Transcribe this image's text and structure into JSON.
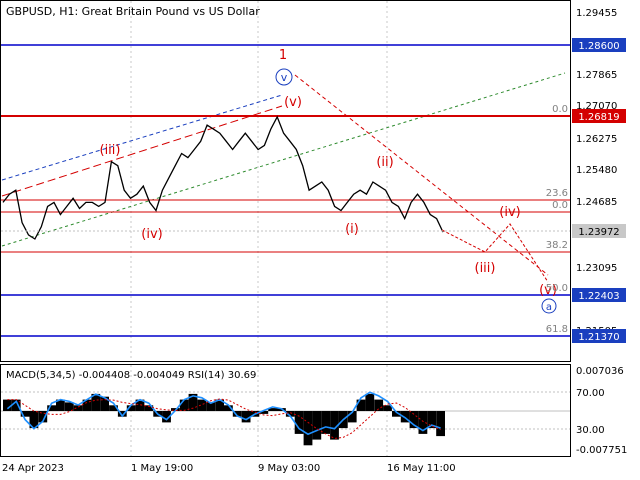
{
  "header": {
    "symbol": "GBPUSD",
    "timeframe": "H1",
    "title": "GBPUSD, H1:  Great Britain Pound vs US Dollar"
  },
  "colors": {
    "price_line": "#000000",
    "red_level": "#d40000",
    "blue_level": "#0000cc",
    "price_label_bg": "#1a3fbf",
    "wave_label": "#d40000",
    "wave_blue": "#1a3fbf",
    "trend_green": "#2e8b2e",
    "fib_text": "#808080",
    "macd_blue": "#1e90ff",
    "macd_hist": "#000000"
  },
  "chart_data": [
    {
      "type": "line",
      "panel": "price",
      "x_labels": [
        "24 Apr 2023",
        "1 May 19:00",
        "9 May 03:00",
        "16 May 11:00"
      ],
      "y_ticks": [
        "1.29455",
        "1.27865",
        "1.27070",
        "1.26275",
        "1.25480",
        "1.24685",
        "1.23095",
        "1.21505"
      ],
      "ylim": [
        1.208,
        1.2965
      ],
      "series": [
        {
          "values": [
            1.247,
            1.249,
            1.25,
            1.242,
            1.239,
            1.238,
            1.241,
            1.246,
            1.247,
            1.244,
            1.246,
            1.248,
            1.2455,
            1.247,
            1.247,
            1.246,
            1.247,
            1.257,
            1.256,
            1.25,
            1.248,
            1.249,
            1.251,
            1.247,
            1.245,
            1.25,
            1.253,
            1.256,
            1.259,
            1.258,
            1.26,
            1.262,
            1.266,
            1.265,
            1.264,
            1.262,
            1.26,
            1.262,
            1.264,
            1.262,
            1.26,
            1.261,
            1.265,
            1.268,
            1.264,
            1.262,
            1.26,
            1.256,
            1.25,
            1.251,
            1.252,
            1.25,
            1.246,
            1.245,
            1.247,
            1.249,
            1.25,
            1.249,
            1.252,
            1.251,
            1.25,
            1.247,
            1.246,
            1.243,
            1.247,
            1.249,
            1.247,
            1.244,
            1.243,
            1.2397
          ]
        }
      ],
      "levels": [
        {
          "price": "1.28600",
          "color": "#0000cc"
        },
        {
          "price": "1.26819",
          "color": "#d40000"
        },
        {
          "price": "1.22403",
          "color": "#0000cc"
        },
        {
          "price": "1.21370",
          "color": "#0000cc"
        }
      ],
      "current_price": "1.23972",
      "fib_labels": [
        "0.0",
        "23.6",
        "0.0",
        "38.2",
        "50.0",
        "61.8"
      ],
      "wave_labels": [
        "1",
        "v",
        "(v)",
        "(iii)",
        "(iv)",
        "(ii)",
        "(i)",
        "(iii)",
        "(iv)",
        "(v)",
        "a"
      ]
    },
    {
      "type": "line",
      "panel": "indicator",
      "label": "MACD(5,34,5) -0.004408 -0.004049 RSI(14) 30.69",
      "y_ticks": [
        "0.007036",
        "70.00",
        "30.00",
        "-0.007751"
      ],
      "series": [
        {
          "name": "MACD histogram",
          "values": [
            0.002,
            0.002,
            -0.001,
            -0.003,
            -0.002,
            0.001,
            0.002,
            0.0015,
            0.001,
            0.002,
            0.003,
            0.0025,
            0.001,
            -0.001,
            0.001,
            0.002,
            0.001,
            -0.001,
            -0.002,
            0.0005,
            0.002,
            0.003,
            0.002,
            0.0015,
            0.002,
            0.001,
            -0.001,
            -0.002,
            -0.001,
            -0.0005,
            0.0005,
            0.0005,
            -0.001,
            -0.004,
            -0.006,
            -0.005,
            -0.004,
            -0.005,
            -0.003,
            -0.002,
            0.002,
            0.003,
            0.002,
            0.001,
            -0.001,
            -0.002,
            -0.003,
            -0.004,
            -0.003,
            -0.0044
          ]
        },
        {
          "name": "RSI(14)",
          "values": [
            52,
            60,
            40,
            30,
            38,
            58,
            62,
            60,
            56,
            62,
            68,
            64,
            58,
            44,
            56,
            62,
            58,
            46,
            40,
            50,
            62,
            66,
            64,
            58,
            62,
            56,
            44,
            40,
            46,
            50,
            54,
            52,
            44,
            30,
            24,
            28,
            32,
            30,
            40,
            48,
            64,
            70,
            66,
            60,
            48,
            42,
            34,
            28,
            34,
            30.69
          ]
        }
      ]
    }
  ]
}
